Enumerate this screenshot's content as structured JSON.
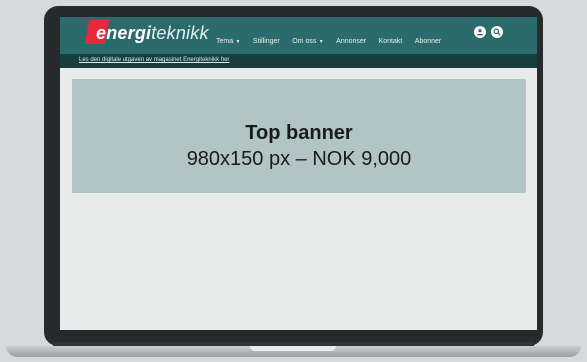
{
  "site": {
    "logo_part1": "energi",
    "logo_part2": "teknikk",
    "brand_color": "#2b6b6b",
    "accent_color": "#e8283c"
  },
  "nav": {
    "items": [
      {
        "label": "Tema",
        "dropdown": true
      },
      {
        "label": "Stillinger",
        "dropdown": false
      },
      {
        "label": "Om oss",
        "dropdown": true
      },
      {
        "label": "Annonser",
        "dropdown": false
      },
      {
        "label": "Kontakt",
        "dropdown": false
      },
      {
        "label": "Abonner",
        "dropdown": false
      }
    ],
    "icons": [
      "user-icon",
      "search-icon"
    ]
  },
  "subbar": {
    "link_text": "Les den digitale utgaven av magasinet Energiteknikk her"
  },
  "banner": {
    "title": "Top banner",
    "subtitle": "980x150 px – NOK 9,000"
  }
}
